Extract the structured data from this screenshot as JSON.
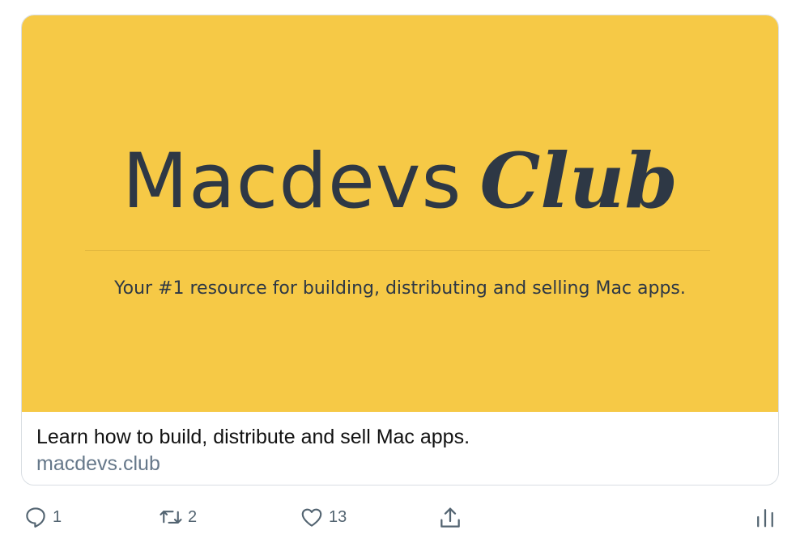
{
  "card": {
    "banner_title_plain": "Macdevs",
    "banner_title_script": "Club",
    "banner_tagline": "Your #1 resource for building, distributing and selling Mac apps.",
    "banner_color": "#f6c946",
    "description": "Learn how to build, distribute and sell Mac apps.",
    "domain": "macdevs.club"
  },
  "actions": {
    "reply": {
      "icon": "reply-icon",
      "count": "1"
    },
    "retweet": {
      "icon": "retweet-icon",
      "count": "2"
    },
    "like": {
      "icon": "heart-icon",
      "count": "13"
    },
    "share": {
      "icon": "share-icon"
    },
    "analytics": {
      "icon": "analytics-icon"
    }
  }
}
